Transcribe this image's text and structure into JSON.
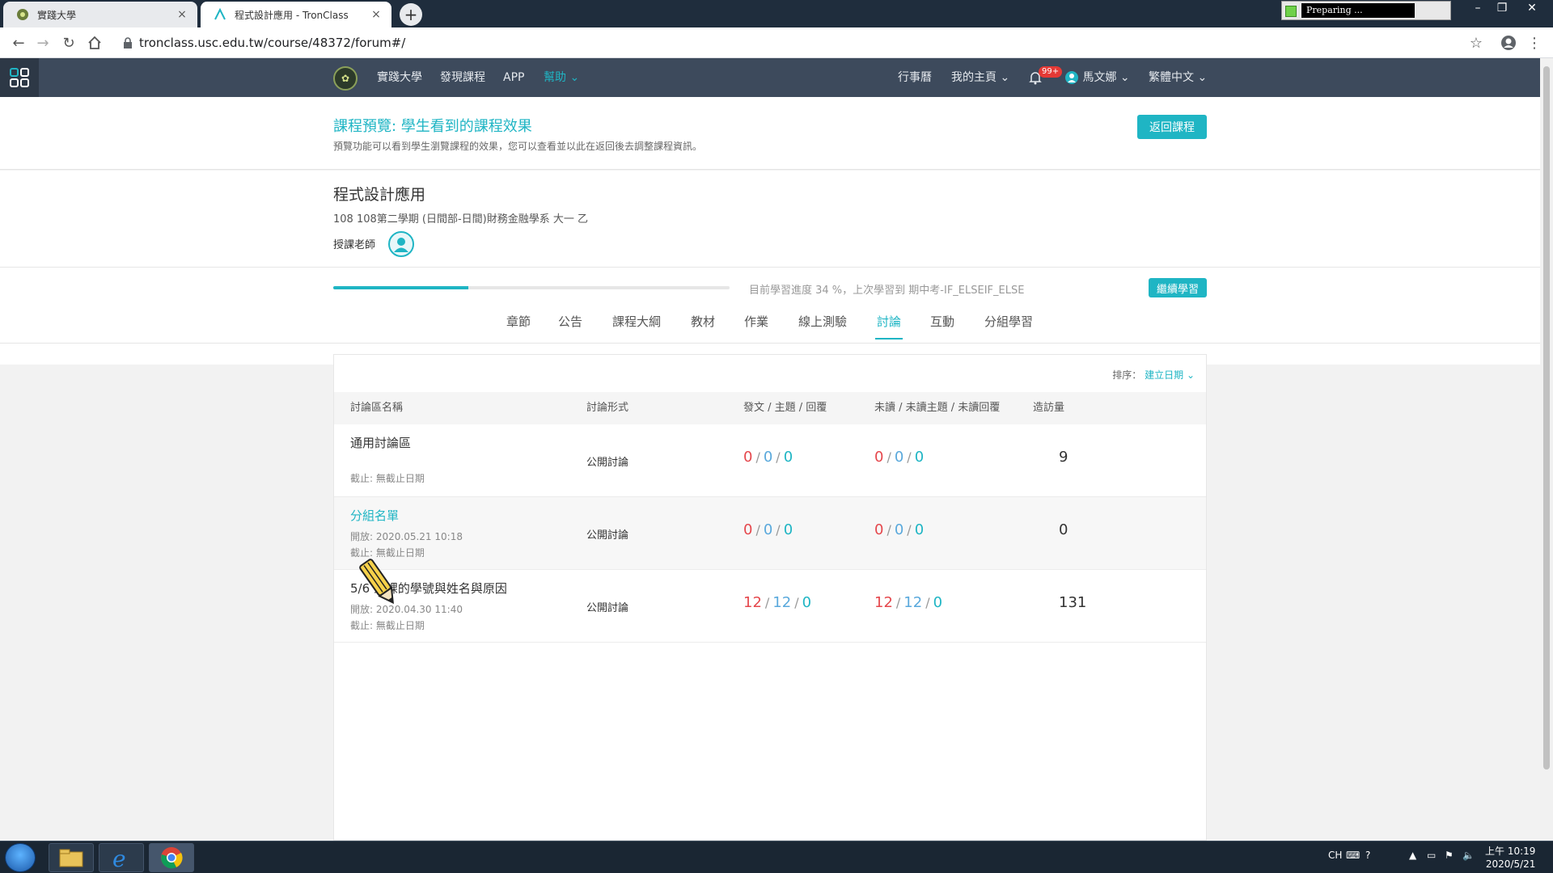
{
  "browser": {
    "tabs": [
      {
        "title": "實踐大學",
        "close": "×"
      },
      {
        "title": "程式設計應用 - TronClass",
        "close": "×"
      }
    ],
    "new_tab": "+",
    "url": "tronclass.usc.edu.tw/course/48372/forum#/",
    "overlay_label": "Preparing ..."
  },
  "header": {
    "nav": [
      "實踐大學",
      "發現課程",
      "APP",
      "幫助"
    ],
    "right": [
      "行事曆",
      "我的主頁",
      "馬文娜",
      "繁體中文"
    ],
    "badge": "99+"
  },
  "preview": {
    "title": "課程預覽: 學生看到的課程效果",
    "desc": "預覽功能可以看到學生瀏覽課程的效果，您可以查看並以此在返回後去調整課程資訊。",
    "back_button": "返回課程"
  },
  "course": {
    "title": "程式設計應用",
    "subtitle": "108 108第二學期 (日間部-日間)財務金融學系 大一 乙",
    "teacher_label": "授課老師",
    "progress_percent": 34,
    "progress_text": "目前學習進度 34 %，上次學習到 期中考-IF_ELSEIF_ELSE",
    "continue_button": "繼續學習"
  },
  "tabs": [
    "章節",
    "公告",
    "課程大綱",
    "教材",
    "作業",
    "線上測驗",
    "討論",
    "互動",
    "分組學習"
  ],
  "active_tab": "討論",
  "forum": {
    "sort_label": "排序：",
    "sort_value": "建立日期",
    "columns": [
      "討論區名稱",
      "討論形式",
      "發文 / 主題 / 回覆",
      "未讀 / 未讀主題 / 未讀回覆",
      "造訪量"
    ],
    "rows": [
      {
        "title": "通用討論區",
        "open": "",
        "deadline": "截止:  無截止日期",
        "type": "公開討論",
        "stats": [
          "0",
          "0",
          "0"
        ],
        "unread": [
          "0",
          "0",
          "0"
        ],
        "visits": "9"
      },
      {
        "title": "分組名單",
        "open": "開放:  2020.05.21 10:18",
        "deadline": "截止:  無截止日期",
        "type": "公開討論",
        "stats": [
          "0",
          "0",
          "0"
        ],
        "unread": [
          "0",
          "0",
          "0"
        ],
        "visits": "0"
      },
      {
        "title": "5/6 到課的學號與姓名與原因",
        "open": "開放:  2020.04.30 11:40",
        "deadline": "截止:  無截止日期",
        "type": "公開討論",
        "stats": [
          "12",
          "12",
          "0"
        ],
        "unread": [
          "12",
          "12",
          "0"
        ],
        "visits": "131"
      }
    ]
  },
  "taskbar": {
    "lang": "CH",
    "time": "上午 10:19",
    "date": "2020/5/21"
  },
  "colors": {
    "accent": "#1fb5c4",
    "header": "#3d4a5c",
    "red": "#e5484d",
    "blue": "#5aa9dc"
  }
}
